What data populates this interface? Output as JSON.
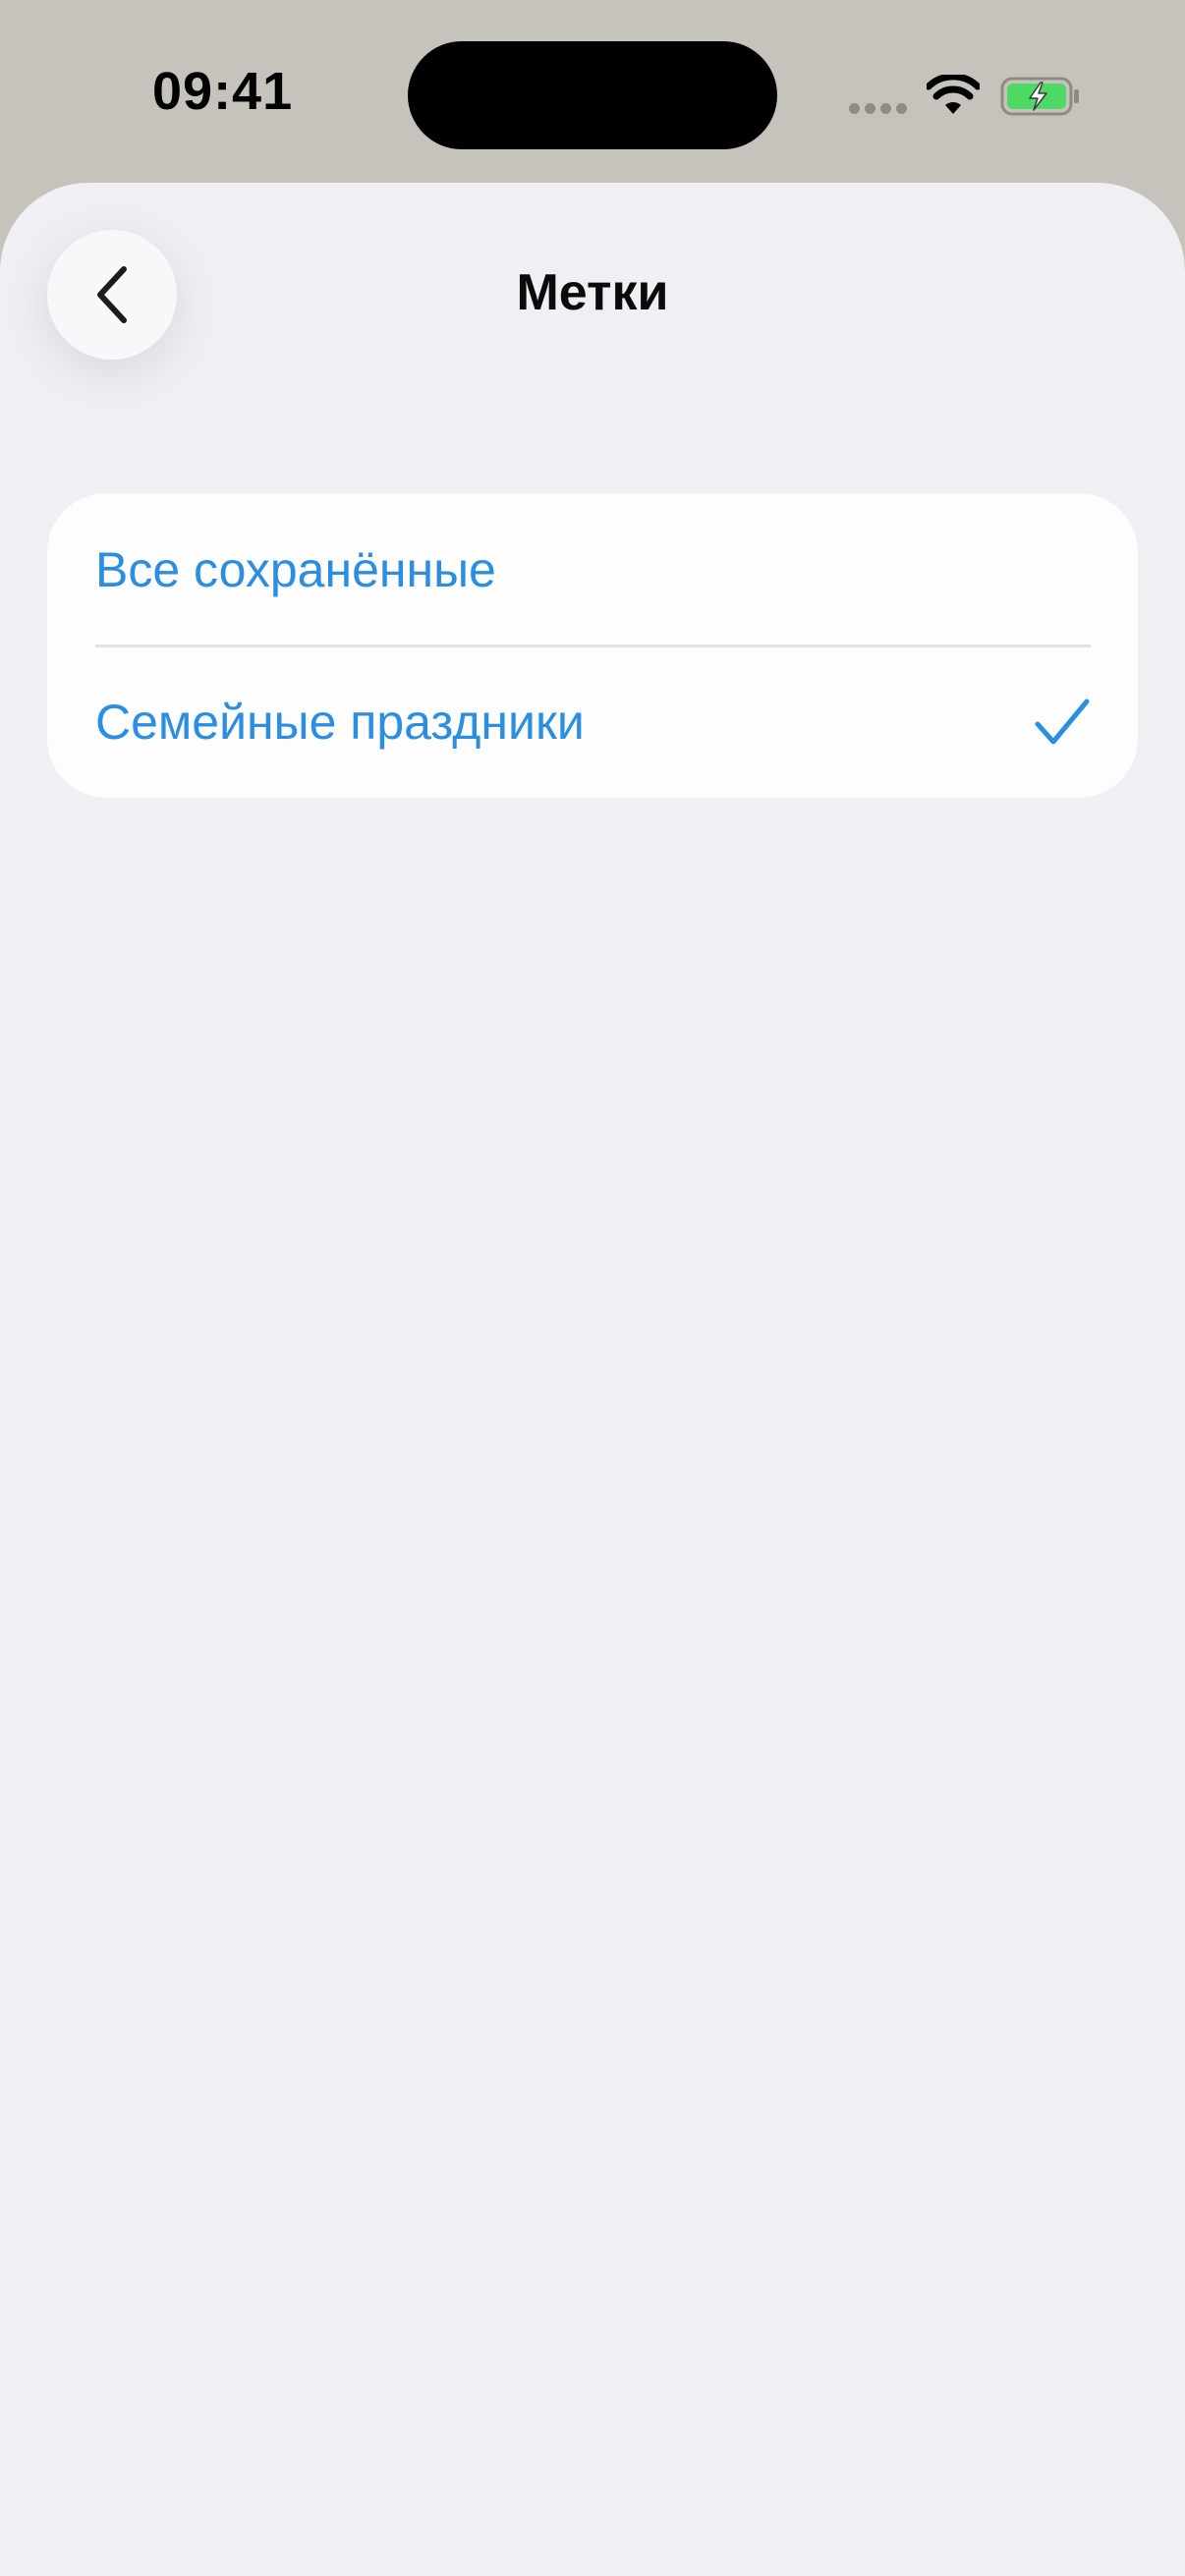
{
  "status_bar": {
    "time": "09:41",
    "icons": [
      "signal-dots-icon",
      "wifi-icon",
      "battery-charging-icon"
    ]
  },
  "nav": {
    "title": "Метки",
    "back_icon": "chevron-left-icon"
  },
  "labels": {
    "items": [
      {
        "label": "Все сохранённые",
        "selected": false
      },
      {
        "label": "Семейные праздники",
        "selected": true
      }
    ],
    "selected_icon": "checkmark-icon"
  },
  "colors": {
    "accent": "#2b8ee0",
    "background": "#efeff4",
    "card": "#fdfdfd",
    "status_bar_bg": "#c6c3bd",
    "battery_fill": "#4cd964"
  }
}
